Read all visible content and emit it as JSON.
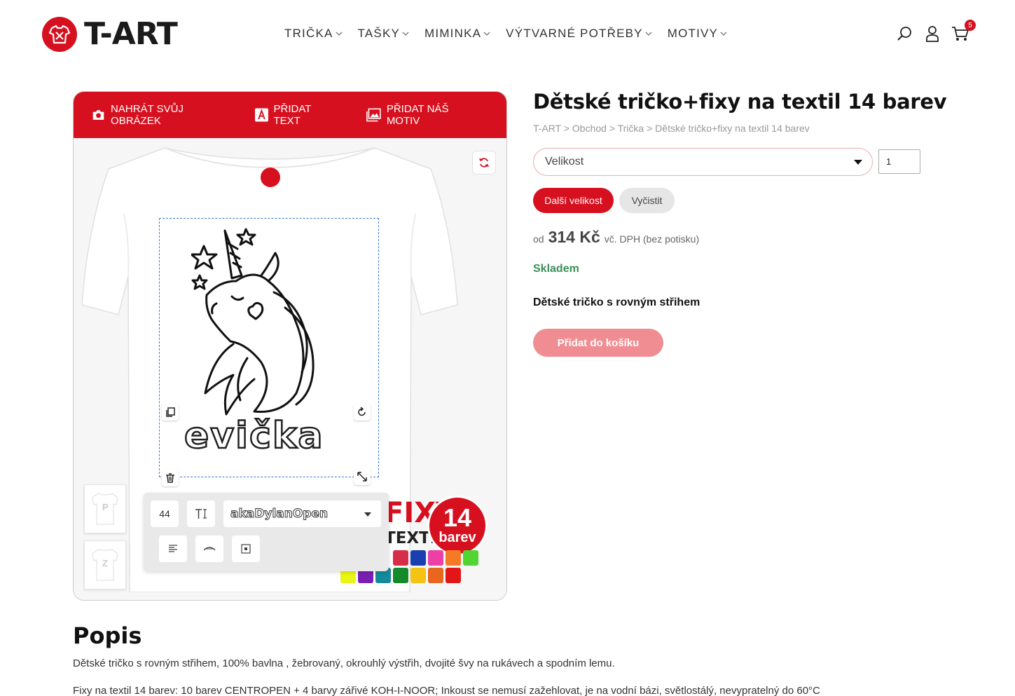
{
  "header": {
    "logo_text": "T-ART",
    "nav": [
      "TRIČKA",
      "TAŠKY",
      "MIMINKA",
      "VÝTVARNÉ POTŘEBY",
      "MOTIVY"
    ],
    "cart_count": "5",
    "brand_color": "#d7101f"
  },
  "designer": {
    "upload_label": "NAHRÁT SVŮJ OBRÁZEK",
    "add_text_label": "PŘIDAT TEXT",
    "add_motif_label": "PŘIDAT NÁŠ MOTIV",
    "text_value": "evička",
    "thumb_front": "P",
    "thumb_back": "Z",
    "font_size": "44",
    "font_name": "akaDylanOpen",
    "promo_fixy": "FIXY",
    "promo_textil": "TEXTIL",
    "promo_number": "14",
    "promo_label": "barev"
  },
  "product": {
    "title": "Dětské tričko+fixy na textil 14 barev",
    "breadcrumb": "T-ART > Obchod > Trička > Dětské tričko+fixy na textil 14 barev",
    "size_placeholder": "Velikost",
    "quantity": "1",
    "next_size_label": "Další velikost",
    "clear_label": "Vyčistit",
    "price_prefix": "od",
    "price": "314 Kč",
    "price_suffix": "vč. DPH (bez potisku)",
    "stock": "Skladem",
    "short_desc": "Dětské tričko s rovným střihem",
    "add_to_cart_label": "Přidat do košíku"
  },
  "description": {
    "heading": "Popis",
    "p1": "Dětské tričko s rovným střihem, 100% bavlna , žebrovaný, okrouhlý výstřih, dvojité švy na rukávech a spodním lemu.",
    "p2": "Fixy na textil 14 barev:  10 barev CENTROPEN + 4 barvy zářivé KOH-I-NOOR; Inkoust se nemusí zažehlovat,  je na vodní bázi, světlostálý, nevypratelný do  60°C"
  }
}
